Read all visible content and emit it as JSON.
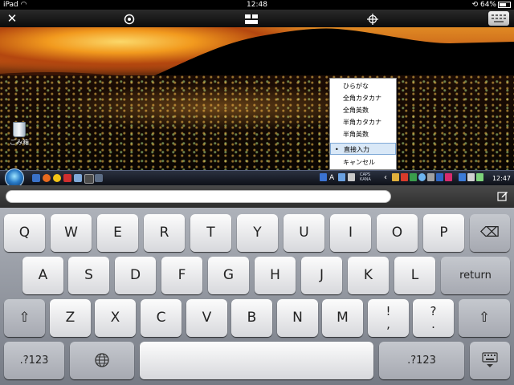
{
  "status_bar": {
    "device": "iPad",
    "time": "12:48",
    "battery": "64%"
  },
  "remote_toolbar": {
    "close_glyph": "✕",
    "icons": [
      "settings-icon",
      "screen-layout-icon",
      "move-crosshair-icon",
      "keyboard-toggle-icon"
    ]
  },
  "desktop": {
    "trash_label": "ごみ箱",
    "ime_menu": {
      "items": [
        "ひらがな",
        "全角カタカナ",
        "全角英数",
        "半角カタカナ",
        "半角英数",
        "直接入力",
        "キャンセル"
      ],
      "selected_index": 5,
      "bullet": "•"
    },
    "taskbar": {
      "caps_label": "CAPS",
      "kana_label": "KANA",
      "clock": "12:47",
      "tray_letter": "A",
      "tray_arrow": "‹"
    }
  },
  "text_entry": {
    "value": ""
  },
  "keyboard": {
    "row1": [
      "Q",
      "W",
      "E",
      "R",
      "T",
      "Y",
      "U",
      "I",
      "O",
      "P"
    ],
    "row2": [
      "A",
      "S",
      "D",
      "F",
      "G",
      "H",
      "J",
      "K",
      "L"
    ],
    "row3": [
      "Z",
      "X",
      "C",
      "V",
      "B",
      "N",
      "M"
    ],
    "return_label": "return",
    "numbers_label": ".?123",
    "punct_1": [
      "!",
      ","
    ],
    "punct_2": [
      "?",
      "."
    ],
    "backspace_glyph": "⌫",
    "shift_glyph": "⇧",
    "globe_glyph": "🌐",
    "hide_glyph": "⌨"
  },
  "colors": {
    "menu_selected": "#d9e8f7",
    "toolbar": "#111111"
  }
}
